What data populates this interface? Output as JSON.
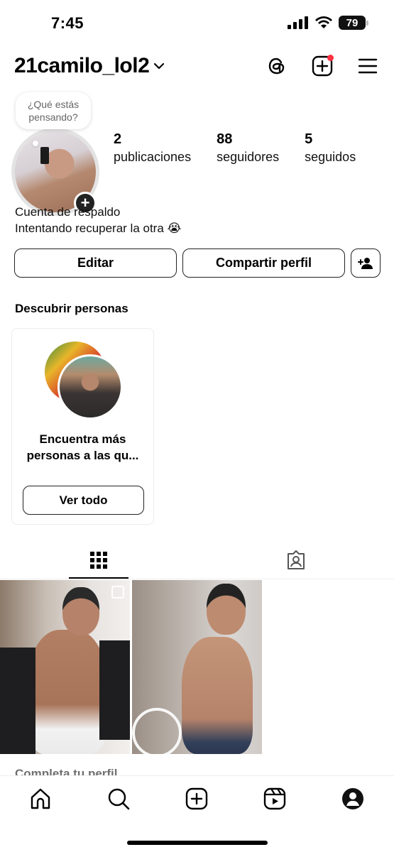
{
  "status_bar": {
    "time": "7:45",
    "battery": "79"
  },
  "header": {
    "username": "21camilo_lol2",
    "icons": [
      "threads-icon",
      "create-post-icon",
      "menu-icon"
    ]
  },
  "profile": {
    "note": "¿Qué estás pensando?",
    "stats": [
      {
        "value": "2",
        "label": "publicaciones"
      },
      {
        "value": "88",
        "label": "seguidores"
      },
      {
        "value": "5",
        "label": "seguidos"
      }
    ],
    "bio_line1": "Cuenta de respaldo",
    "bio_line2": "Intentando recuperar la otra 😭"
  },
  "actions": {
    "edit": "Editar",
    "share": "Compartir perfil"
  },
  "discover": {
    "title": "Descubrir personas",
    "card_text": "Encuentra más personas a las qu...",
    "button": "Ver todo"
  },
  "tabs": [
    "grid-icon",
    "tagged-icon"
  ],
  "posts_count_visible": 2,
  "cutoff_text": "Completa tu perfil",
  "bottom_nav": [
    "home-icon",
    "search-icon",
    "create-icon",
    "reels-icon",
    "profile-icon"
  ]
}
